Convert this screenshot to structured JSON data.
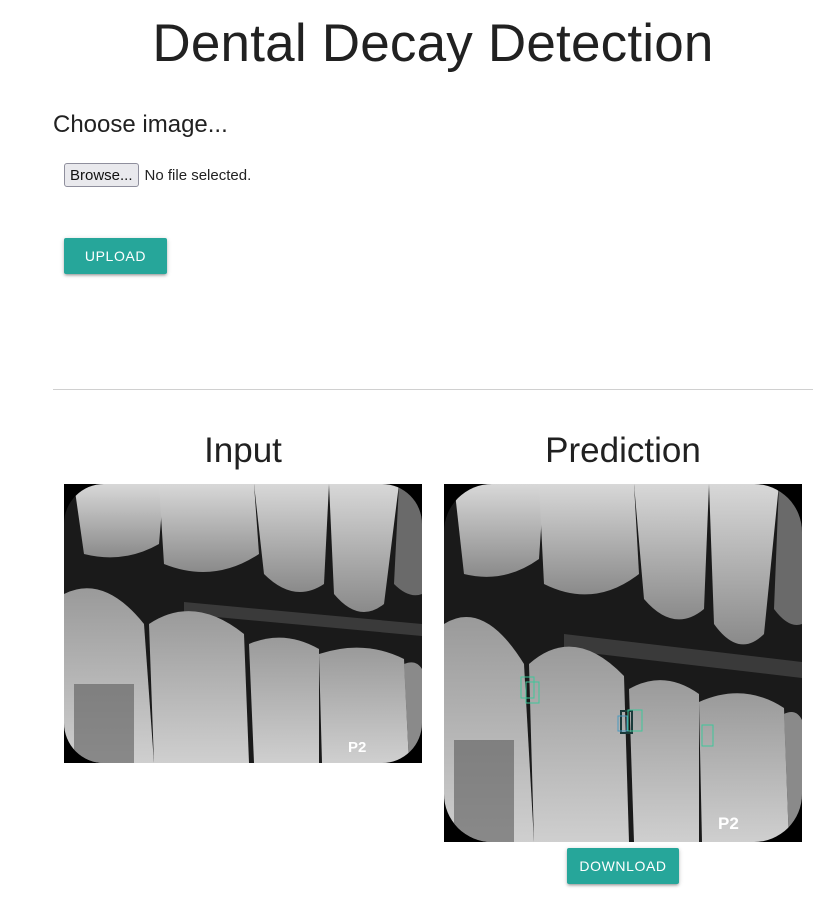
{
  "page": {
    "title": "Dental Decay Detection"
  },
  "upload_form": {
    "choose_label": "Choose image...",
    "browse_button": "Browse...",
    "file_status": "No file selected.",
    "upload_button": "UPLOAD"
  },
  "results": {
    "input_title": "Input",
    "prediction_title": "Prediction",
    "download_button": "DOWNLOAD",
    "input_image_label": "P2",
    "prediction_image_label": "P2",
    "detection_count": 3
  },
  "colors": {
    "accent": "#26a69a",
    "detection_box": "#3fc79a"
  }
}
